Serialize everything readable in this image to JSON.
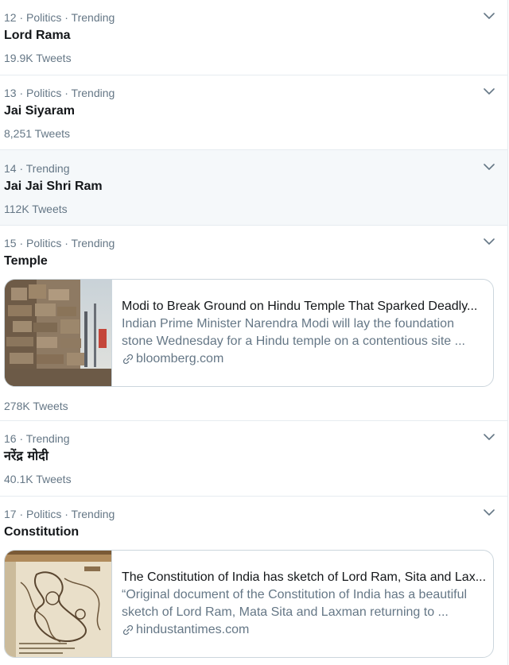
{
  "trends": [
    {
      "meta": "12 · Politics · Trending",
      "name": "Lord Rama",
      "count": "19.9K Tweets"
    },
    {
      "meta": "13 · Politics · Trending",
      "name": "Jai Siyaram",
      "count": "8,251 Tweets"
    },
    {
      "meta": "14 · Trending",
      "name": "Jai Jai Shri Ram",
      "count": "112K Tweets"
    },
    {
      "meta": "15 · Politics · Trending",
      "name": "Temple",
      "count": "278K Tweets",
      "card": {
        "title": "Modi to Break Ground on Hindu Temple That Sparked Deadly...",
        "description_line1": "Indian Prime Minister Narendra Modi will lay the foundation",
        "description_line2": "stone Wednesday for a Hindu temple on a contentious site ...",
        "domain": "bloomberg.com"
      }
    },
    {
      "meta": "16 · Trending",
      "name": "नरेंद्र मोदी",
      "count": "40.1K Tweets"
    },
    {
      "meta": "17 · Politics · Trending",
      "name": "Constitution",
      "card": {
        "title": "The Constitution of India has sketch of Lord Ram, Sita and Lax...",
        "description_line1": "“Original document of the Constitution of India has a beautiful",
        "description_line2": "sketch of Lord Ram, Mata Sita and Laxman returning to ...",
        "domain": "hindustantimes.com"
      }
    }
  ],
  "colors": {
    "primary_text": "#14171a",
    "secondary_text": "#657786",
    "border": "#e6ecf0",
    "card_border": "#ccd6dd",
    "highlight_bg": "#f5f8fa"
  }
}
